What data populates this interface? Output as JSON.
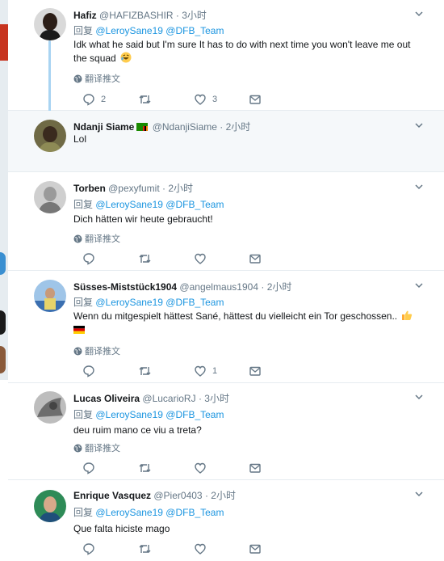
{
  "reply_prefix": "回复",
  "translate_label": "翻译推文",
  "tweets": [
    {
      "name": "Hafiz",
      "handle": "@HAFIZBASHIR",
      "time": "3小时",
      "mentions": [
        "@LeroySane19",
        "@DFB_Team"
      ],
      "text_line1": "Idk what he said but I'm sure It has to do with next time you won't leave me out",
      "text_line2": "the squad",
      "replies": "2",
      "likes": "3"
    },
    {
      "name": "Ndanji Siame",
      "handle": "@NdanjiSiame",
      "time": "2小时",
      "text": "Lol"
    },
    {
      "name": "Torben",
      "handle": "@pexyfumit",
      "time": "2小时",
      "mentions": [
        "@LeroySane19",
        "@DFB_Team"
      ],
      "text": "Dich hätten wir heute gebraucht!"
    },
    {
      "name": "Süsses-Miststück1904",
      "handle": "@angelmaus1904",
      "time": "2小时",
      "mentions": [
        "@LeroySane19",
        "@DFB_Team"
      ],
      "text": "Wenn du mitgespielt hättest Sané, hättest du vielleicht ein Tor geschossen..",
      "likes": "1"
    },
    {
      "name": "Lucas Oliveira",
      "handle": "@LucarioRJ",
      "time": "3小时",
      "mentions": [
        "@LeroySane19",
        "@DFB_Team"
      ],
      "text": "deu ruim mano ce viu a treta?"
    },
    {
      "name": "Enrique Vasquez",
      "handle": "@Pier0403",
      "time": "2小时",
      "mentions": [
        "@LeroySane19",
        "@DFB_Team"
      ],
      "text": "Que falta hiciste mago"
    }
  ]
}
